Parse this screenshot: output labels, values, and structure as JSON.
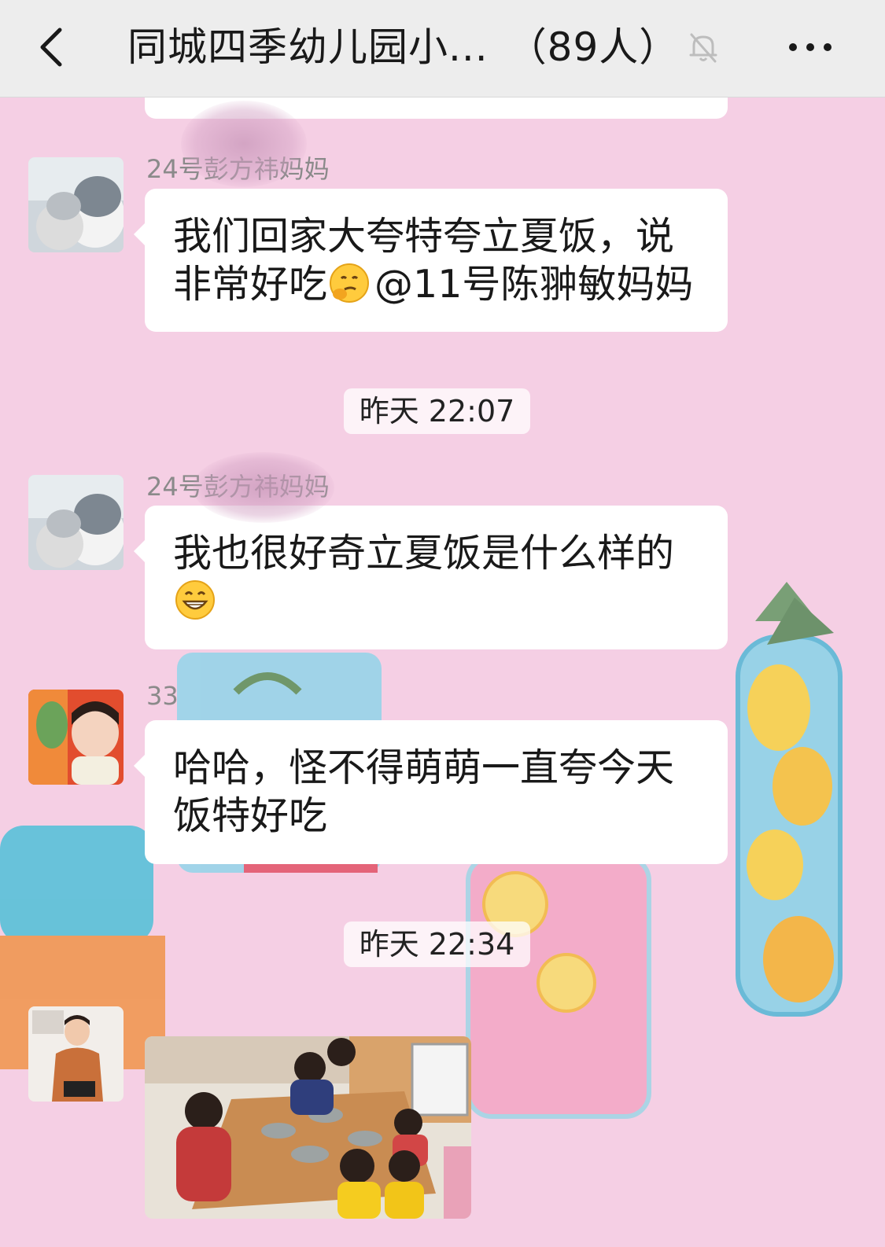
{
  "header": {
    "title": "同城四季幼儿园小...",
    "member_count": "（89人）",
    "back_icon": "chevron-left-icon",
    "mute_icon": "bell-muted-icon",
    "more_icon": "more-dots-icon",
    "background": "#ededed"
  },
  "chat": {
    "background": "#f5cfe4",
    "bubble_color": "#ffffff",
    "messages": [
      {
        "sender": "24号彭方祎妈妈",
        "line1": "我们回家大夸特夸立夏饭，说",
        "line2_prefix": "非常好吃",
        "emoji": "thinking-face-icon",
        "mention": "@11号陈翀敏妈妈"
      },
      {
        "sender": "24号彭方祎妈妈",
        "line1": "我也很好奇立夏饭是什么样的",
        "emoji": "grinning-face-icon"
      },
      {
        "sender": "33",
        "line1": "哈哈，怪不得萌萌一直夸今天",
        "line2": "饭特好吃"
      }
    ],
    "timestamps": [
      "昨天 22:07",
      "昨天 22:34"
    ]
  }
}
